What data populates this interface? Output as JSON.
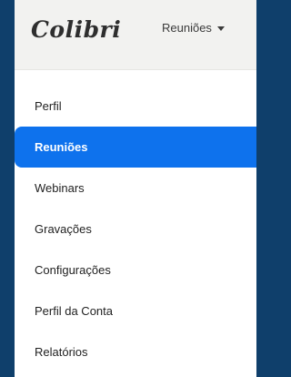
{
  "header": {
    "logo_text": "Colibri",
    "nav_menu_label": "Reuniões"
  },
  "sidebar": {
    "active_index": 1,
    "items": [
      {
        "label": "Perfil"
      },
      {
        "label": "Reuniões"
      },
      {
        "label": "Webinars"
      },
      {
        "label": "Gravações"
      },
      {
        "label": "Configurações"
      },
      {
        "label": "Perfil da Conta"
      },
      {
        "label": "Relatórios"
      }
    ]
  },
  "colors": {
    "page_background": "#0f3f6b",
    "active_item": "#0e72ed",
    "header_background": "#f2f2f0"
  }
}
